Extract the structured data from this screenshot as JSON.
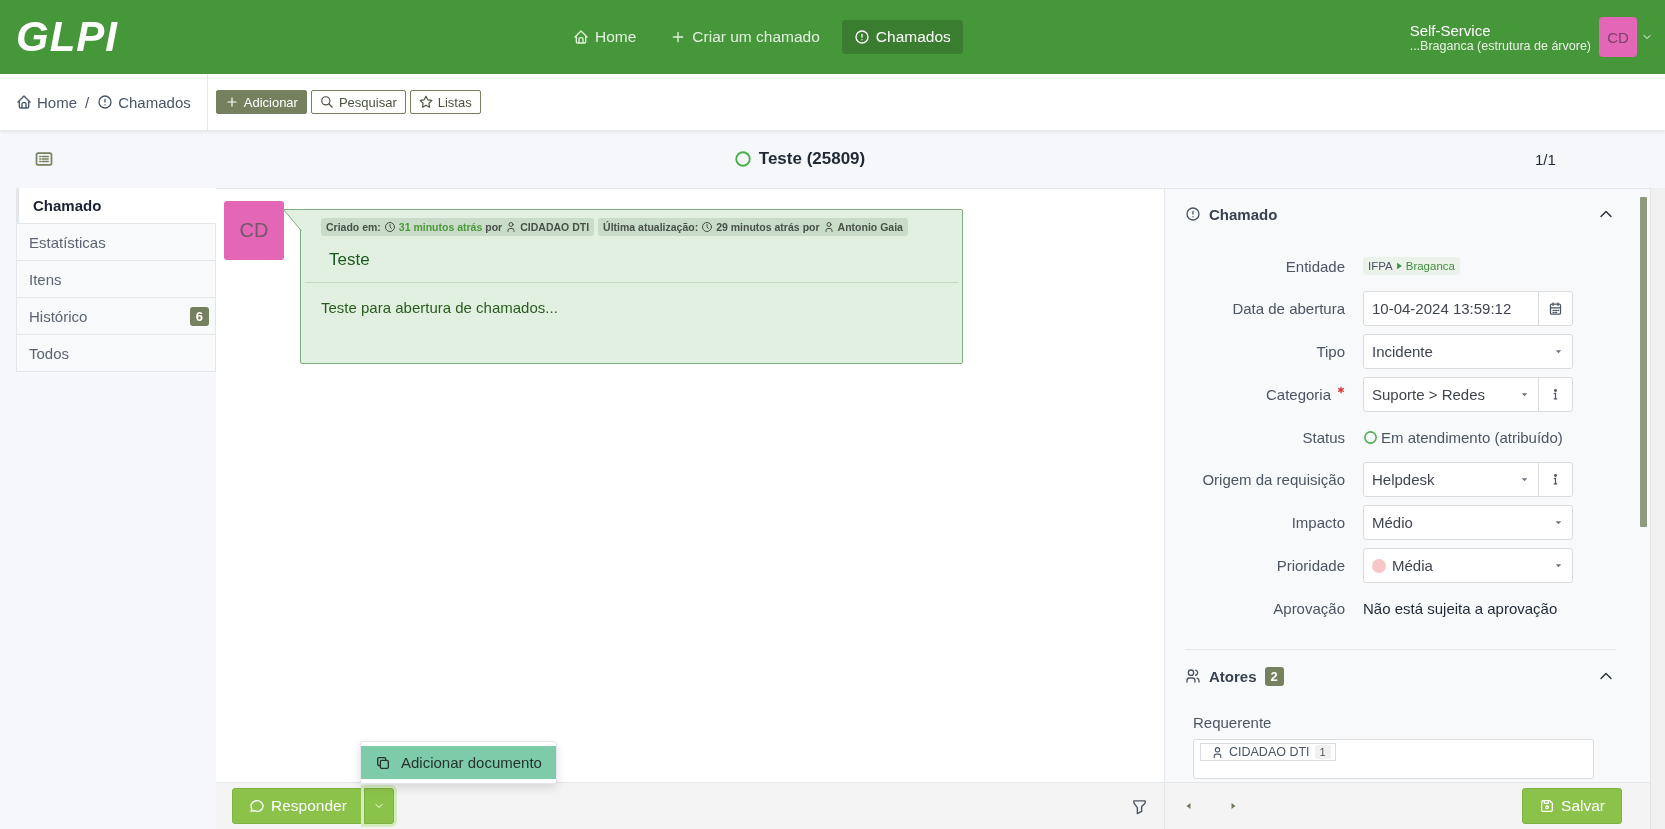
{
  "header": {
    "logo": "GLPI",
    "nav": [
      {
        "label": "Home",
        "selected": false
      },
      {
        "label": "Criar um chamado",
        "selected": false
      },
      {
        "label": "Chamados",
        "selected": true
      }
    ],
    "profile": {
      "name": "Self-Service",
      "entity": "...Braganca (estrutura de árvore)",
      "initials": "CD"
    }
  },
  "breadcrumb": [
    {
      "label": "Home"
    },
    {
      "label": "Chamados"
    }
  ],
  "breadcrumb_separator": "/",
  "actions": [
    {
      "label": "Adicionar",
      "kind": "primary"
    },
    {
      "label": "Pesquisar",
      "kind": "outline"
    },
    {
      "label": "Listas",
      "kind": "outline"
    }
  ],
  "ticket": {
    "title": "Teste (25809)",
    "pager": "1/1"
  },
  "tabs": [
    {
      "label": "Chamado",
      "selected": true
    },
    {
      "label": "Estatísticas",
      "selected": false
    },
    {
      "label": "Itens",
      "selected": false
    },
    {
      "label": "Histórico",
      "selected": false,
      "badge": "6"
    },
    {
      "label": "Todos",
      "selected": false
    }
  ],
  "timeline": {
    "avatar": "CD",
    "meta": [
      {
        "label": "Criado em:",
        "time": "31 minutos atrás",
        "recent": true,
        "by": "por",
        "user": "CIDADAO DTI"
      },
      {
        "label": "Última atualização:",
        "time": "29 minutos atrás",
        "recent": false,
        "by": "por",
        "user": "Antonio Gaia"
      }
    ],
    "title": "Teste",
    "body": "Teste para abertura de chamados..."
  },
  "composer": {
    "reply": "Responder",
    "menu": [
      {
        "label": "Adicionar documento",
        "selected": true
      }
    ]
  },
  "panel": {
    "title": "Chamado",
    "fields": [
      {
        "label": "Entidade",
        "kind": "entity",
        "parent": "IFPA",
        "value": "Braganca",
        "required": false
      },
      {
        "label": "Data de abertura",
        "kind": "datetime",
        "value": "10-04-2024 13:59:12",
        "required": false
      },
      {
        "label": "Tipo",
        "kind": "select",
        "value": "Incidente",
        "required": false
      },
      {
        "label": "Categoria",
        "kind": "select_info",
        "value": "Suporte > Redes",
        "required": true
      },
      {
        "label": "Status",
        "kind": "status",
        "value": "Em atendimento (atribuído)",
        "color": "#4caf50",
        "required": false
      },
      {
        "label": "Origem da requisição",
        "kind": "select_info",
        "value": "Helpdesk",
        "required": false
      },
      {
        "label": "Impacto",
        "kind": "select",
        "value": "Médio",
        "required": false
      },
      {
        "label": "Prioridade",
        "kind": "priority",
        "value": "Média",
        "color": "#f8c6c6",
        "required": false
      },
      {
        "label": "Aprovação",
        "kind": "text",
        "value": "Não está sujeita a aprovação",
        "required": false
      }
    ],
    "actors": {
      "title": "Atores",
      "count": "2",
      "role": "Requerente",
      "people": [
        {
          "name": "CIDADAO DTI",
          "count": "1"
        }
      ]
    },
    "save": "Salvar"
  }
}
